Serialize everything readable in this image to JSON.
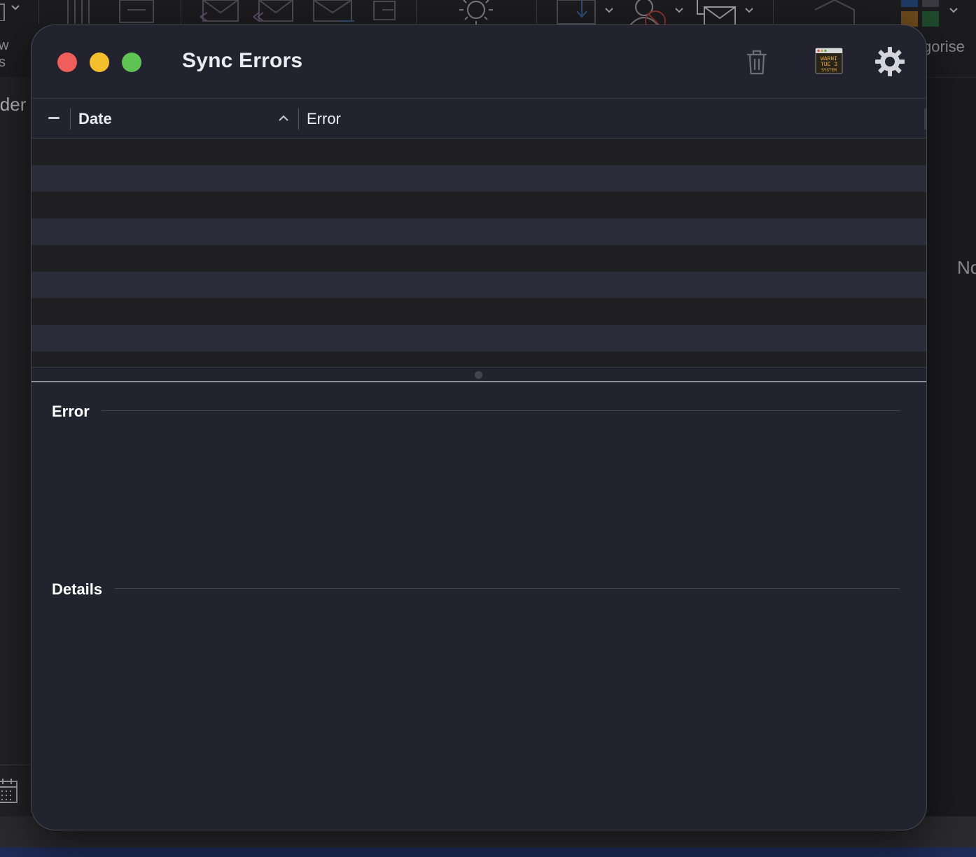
{
  "background_app": {
    "sidebar_partial_label": "lder",
    "toolbar_partial_label_1": "w",
    "toolbar_partial_label_2": "s",
    "categorise_partial_label": "gorise",
    "right_partial_label": "No"
  },
  "window": {
    "title": "Sync Errors",
    "toolbar": {
      "trash_icon": "trash-icon",
      "console_icon": "console-icon",
      "console_icon_text": "WARNING TUE 3: SYSTEM",
      "gear_icon": "gear-icon"
    },
    "table": {
      "columns": [
        {
          "label": "",
          "icon": "flag-dash-icon"
        },
        {
          "label": "Date",
          "sort": "ascending"
        },
        {
          "label": "Error"
        }
      ],
      "rows": []
    },
    "sections": {
      "error_title": "Error",
      "details_title": "Details"
    }
  },
  "colors": {
    "window_bg": "#23232f",
    "row_alt": "#2b2b3a",
    "row_base": "#1f1f22",
    "close": "#ee5f5b",
    "minimize": "#f4bf2d",
    "maximize": "#5fc454"
  }
}
